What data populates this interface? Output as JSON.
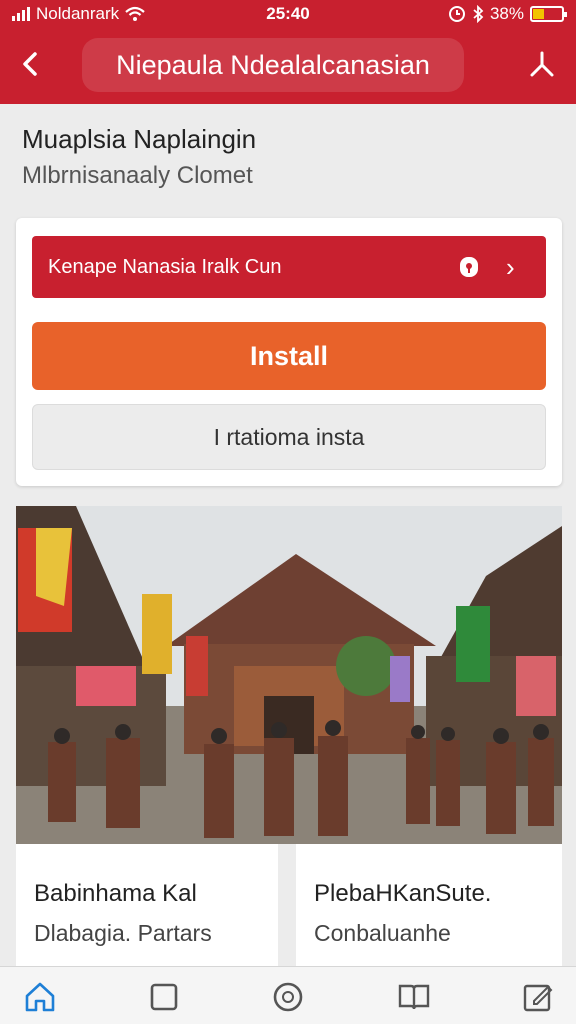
{
  "status_bar": {
    "carrier": "Noldanrark",
    "time": "25:40",
    "battery_percent": "38%",
    "battery_level": 0.38,
    "icons": [
      "signal-icon",
      "wifi-icon",
      "alarm-icon",
      "bluetooth-icon",
      "battery-icon"
    ]
  },
  "header": {
    "title": "Niepaula Ndealalcanasian",
    "back_icon": "back-arrow-icon",
    "share_icon": "share-icon",
    "background_color": "#c8202f"
  },
  "hero": {
    "title": "Muaplsia Naplaingin",
    "subtitle": "Mlbrnisanaaly Clomet"
  },
  "action_card": {
    "link_label": "Kenape Nanasia Iralk Cun",
    "link_icons": [
      "lock-icon",
      "chevron-right-icon"
    ],
    "install_label": "Install",
    "install_color": "#e8622a",
    "secondary_label": "I rtatioma insta"
  },
  "tiles": [
    {
      "title": "Babinhama Kal",
      "subtitle": "Dlabagia. Partars"
    },
    {
      "title": "PlebaHKanSute.",
      "subtitle": "Conbaluanhe"
    }
  ],
  "tab_bar": {
    "items": [
      "home-icon",
      "square-icon",
      "circle-icon",
      "book-icon",
      "edit-icon"
    ],
    "active_index": 0,
    "active_color": "#1e7fd6"
  }
}
